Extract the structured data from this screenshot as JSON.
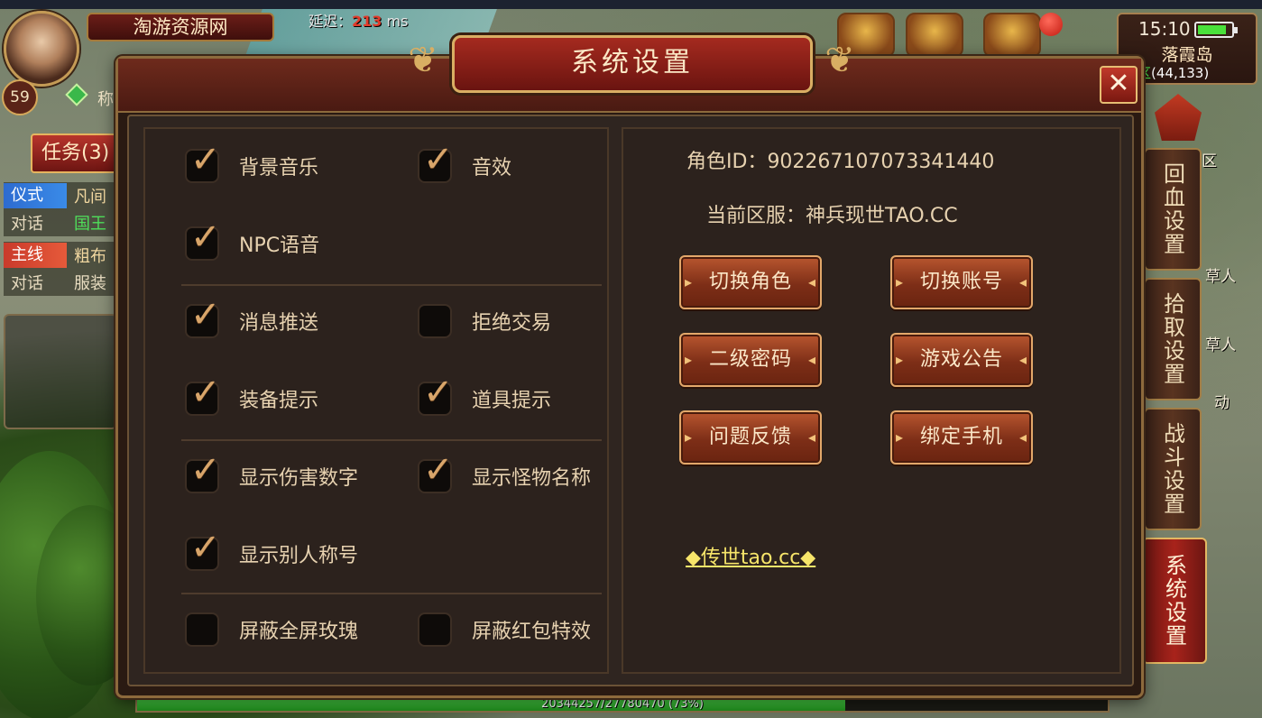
{
  "hud": {
    "site_name": "淘游资源网",
    "delay_label": "延迟：",
    "delay_value": "213",
    "delay_unit": "ms",
    "level": "59",
    "player_name_char": "称",
    "time": "15:10",
    "battery_level": 0.85,
    "map_name": "落霞岛",
    "zone": "全区",
    "coordinates": "(44,133)",
    "task_button": "任务(3)",
    "quests": [
      {
        "tag": "仪式",
        "tag_color": "blue",
        "title": "凡间",
        "sub": "对话",
        "detail": "国王"
      },
      {
        "tag": "主线",
        "tag_color": "red",
        "title": "粗布",
        "sub": "对话",
        "detail": "服装"
      }
    ],
    "side_labels": [
      "区",
      "草人",
      "草人",
      "动"
    ],
    "exp_text": "20344257/27780470 (73%)",
    "exp_percent": 73
  },
  "side_tabs": [
    {
      "label": "回血设置",
      "active": false
    },
    {
      "label": "拾取设置",
      "active": false
    },
    {
      "label": "战斗设置",
      "active": false
    },
    {
      "label": "系统设置",
      "active": true
    }
  ],
  "dialog": {
    "title": "系统设置",
    "close_symbol": "✕",
    "options": [
      {
        "label": "背景音乐",
        "checked": true
      },
      {
        "label": "音效",
        "checked": true
      },
      {
        "label": "NPC语音",
        "checked": true
      },
      {
        "label": "消息推送",
        "checked": true
      },
      {
        "label": "拒绝交易",
        "checked": false
      },
      {
        "label": "装备提示",
        "checked": true
      },
      {
        "label": "道具提示",
        "checked": true
      },
      {
        "label": "显示伤害数字",
        "checked": true
      },
      {
        "label": "显示怪物名称",
        "checked": true
      },
      {
        "label": "显示别人称号",
        "checked": true
      },
      {
        "label": "屏蔽全屏玫瑰",
        "checked": false
      },
      {
        "label": "屏蔽红包特效",
        "checked": false
      }
    ],
    "role_id_label": "角色ID：",
    "role_id": "902267107073341440",
    "server_label": "当前区服：",
    "server": "神兵现世TAO.CC",
    "buttons": [
      "切换角色",
      "切换账号",
      "二级密码",
      "游戏公告",
      "问题反馈",
      "绑定手机"
    ],
    "footer_link": "◆传世tao.cc◆"
  },
  "colors": {
    "checkmark": "#d8a56a",
    "button": "#8c3a1c",
    "title_plate": "#a52a1f",
    "link": "#f7e56a",
    "zone": "#4ef050",
    "delay": "#e23b2a"
  }
}
